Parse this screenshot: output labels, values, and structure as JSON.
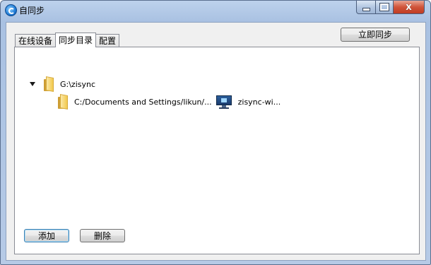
{
  "window": {
    "title": "自同步",
    "app_icon": "zisync-logo-icon",
    "controls": [
      "minimize-icon",
      "maximize-icon",
      "close-icon"
    ],
    "close_glyph": "X"
  },
  "toolbar": {
    "sync_now_label": "立即同步"
  },
  "tabs": [
    {
      "label": "在线设备",
      "active": false
    },
    {
      "label": "同步目录",
      "active": true
    },
    {
      "label": "配置",
      "active": false
    }
  ],
  "tree": {
    "root": {
      "expanded": true,
      "label": "G:\\zisync",
      "icon": "folder-icon"
    },
    "children": [
      {
        "path": "C:/Documents and Settings/likun/...",
        "icon": "folder-icon",
        "device_icon": "computer-monitor-icon",
        "device": "zisync-wi..."
      }
    ]
  },
  "footer": {
    "add_label": "添加",
    "delete_label": "删除"
  }
}
